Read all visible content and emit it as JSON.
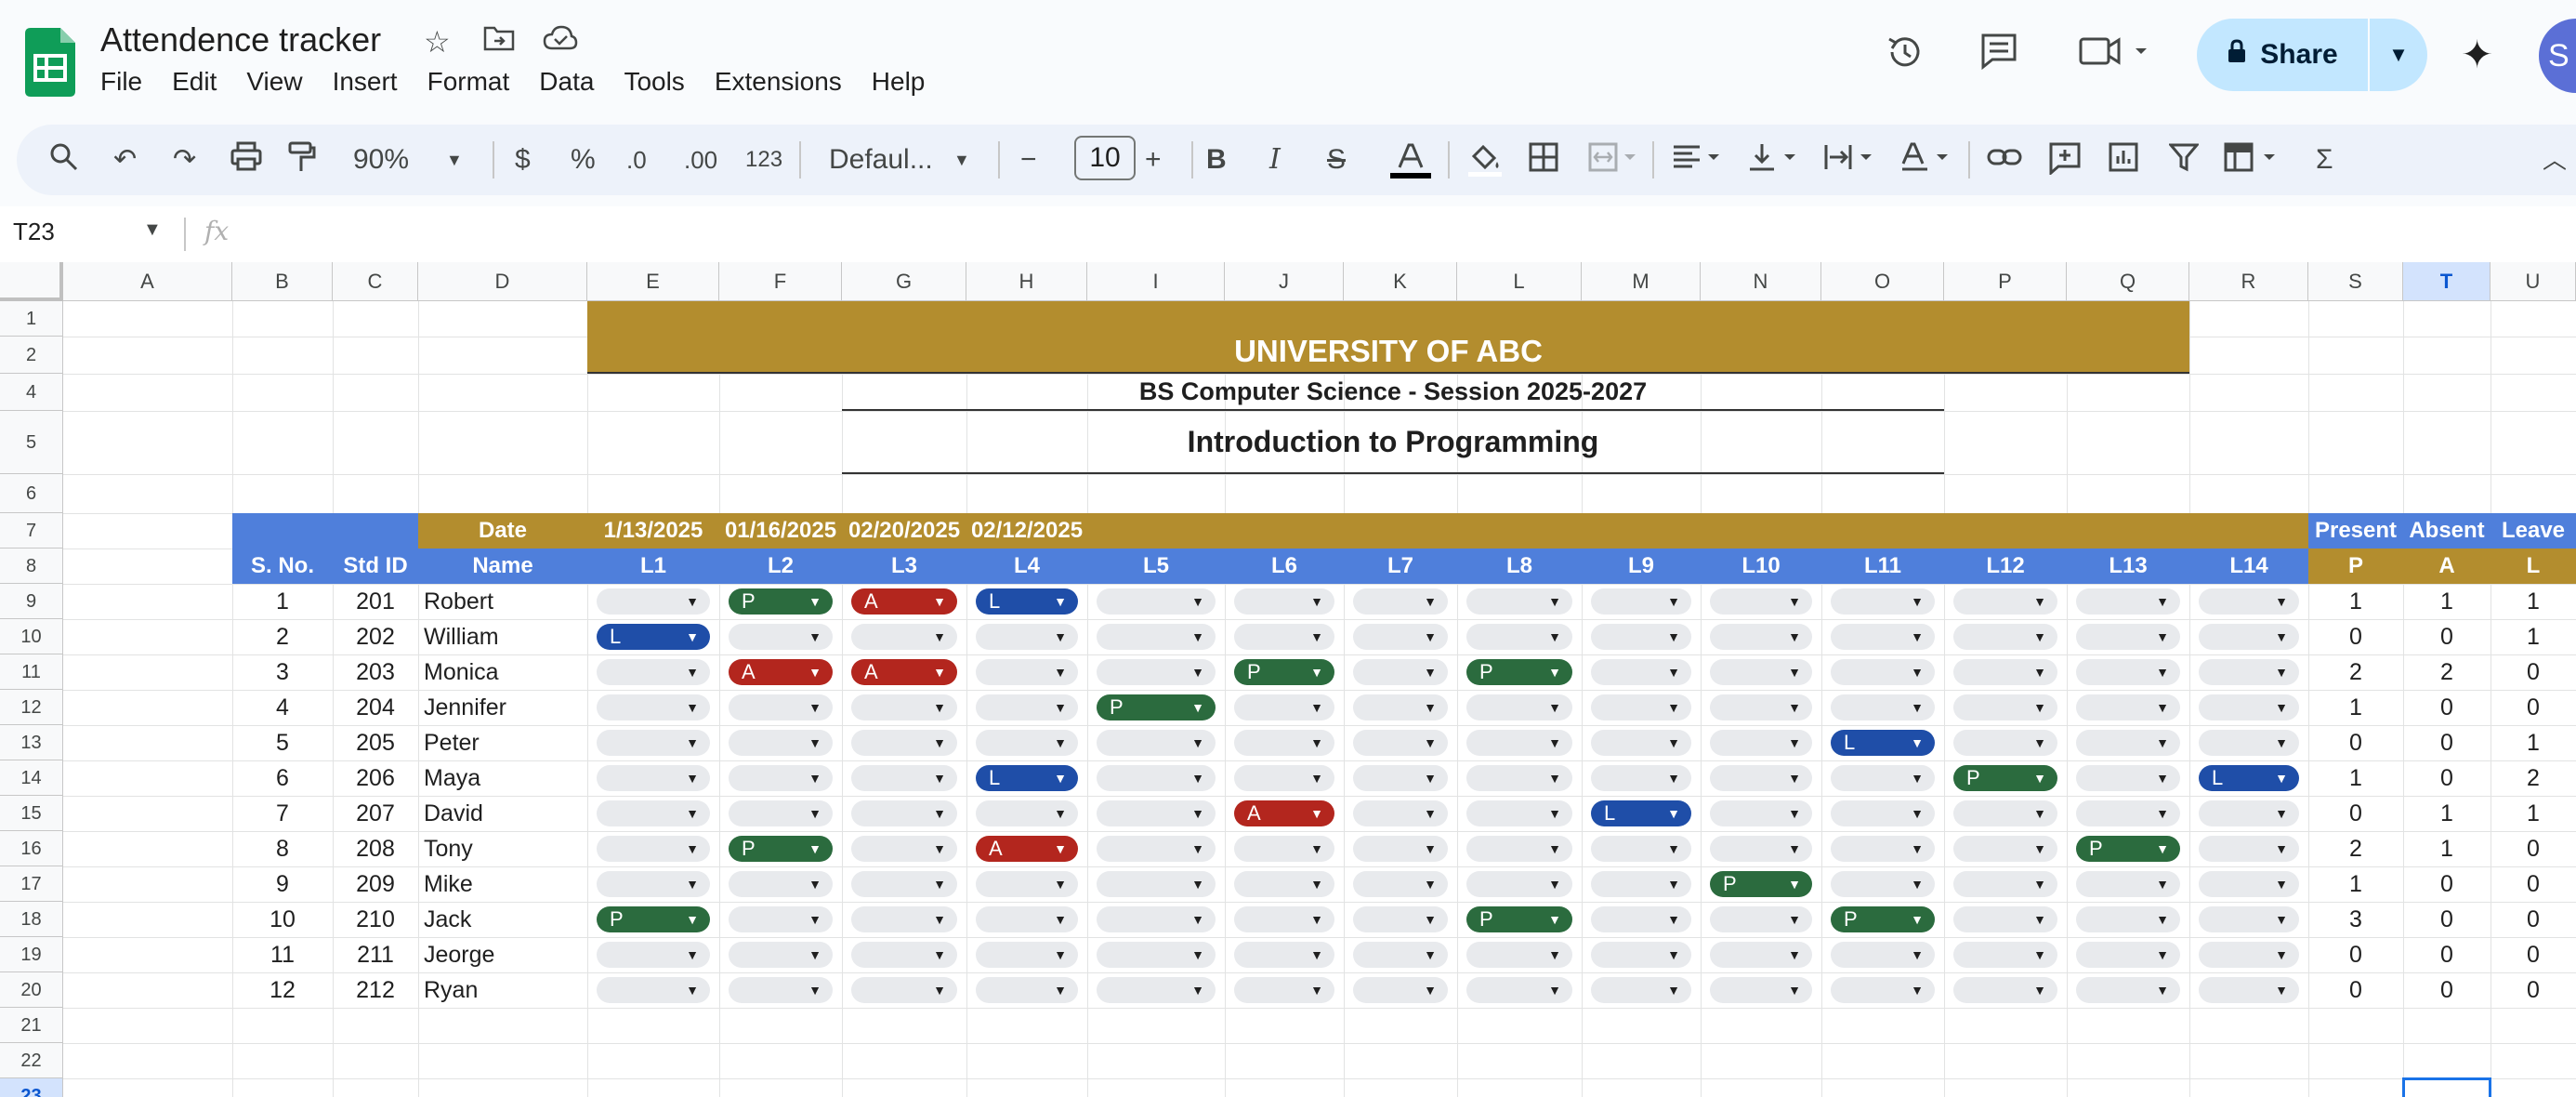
{
  "app": {
    "doc_title": "Attendence tracker",
    "menu": [
      "File",
      "Edit",
      "View",
      "Insert",
      "Format",
      "Data",
      "Tools",
      "Extensions",
      "Help"
    ],
    "share_label": "Share",
    "avatar_initial": "S",
    "brand_color": "#0f9d58",
    "share_color": "#c2e7ff"
  },
  "toolbar": {
    "zoom": "90%",
    "currency": "$",
    "percent": "%",
    "dec_decrease": ".0",
    "dec_increase": ".00",
    "number_format": "123",
    "font": "Defaul...",
    "font_size": "10",
    "bold": "B",
    "italic": "I",
    "sigma": "Σ"
  },
  "formula_bar": {
    "name_box": "T23",
    "fx": "fx",
    "formula": ""
  },
  "grid": {
    "columns": [
      "A",
      "B",
      "C",
      "D",
      "E",
      "F",
      "G",
      "H",
      "I",
      "J",
      "K",
      "L",
      "M",
      "N",
      "O",
      "P",
      "Q",
      "R",
      "S",
      "T",
      "U"
    ],
    "selected_column": "T",
    "rows": [
      "1",
      "2",
      "4",
      "5",
      "6",
      "7",
      "8",
      "9",
      "10",
      "11",
      "12",
      "13",
      "14",
      "15",
      "16",
      "17",
      "18",
      "19",
      "20",
      "21",
      "22",
      "23"
    ],
    "selected_row": "23",
    "colors": {
      "gold": "#b38d2e",
      "blue": "#4f7fdb",
      "present": "#2b6b3e",
      "absent": "#b3261e",
      "leave": "#1f4ea8"
    }
  },
  "sheet": {
    "university": "UNIVERSITY OF ABC",
    "program": "BS Computer Science - Session 2025-2027",
    "course": "Introduction to Programming",
    "date_label": "Date",
    "dates": [
      "1/13/2025",
      "01/16/2025",
      "02/20/2025",
      "02/12/2025"
    ],
    "headers": {
      "sno": "S. No.",
      "std_id": "Std ID",
      "name": "Name"
    },
    "lectures": [
      "L1",
      "L2",
      "L3",
      "L4",
      "L5",
      "L6",
      "L7",
      "L8",
      "L9",
      "L10",
      "L11",
      "L12",
      "L13",
      "L14"
    ],
    "summary_titles": [
      "Present",
      "Absent",
      "Leave"
    ],
    "summary_codes": [
      "P",
      "A",
      "L"
    ],
    "students": [
      {
        "sno": "1",
        "id": "201",
        "name": "Robert",
        "att": [
          "",
          "P",
          "A",
          "L",
          "",
          "",
          "",
          "",
          "",
          "",
          "",
          "",
          "",
          ""
        ],
        "p": "1",
        "a": "1",
        "l": "1"
      },
      {
        "sno": "2",
        "id": "202",
        "name": "William",
        "att": [
          "L",
          "",
          "",
          "",
          "",
          "",
          "",
          "",
          "",
          "",
          "",
          "",
          "",
          ""
        ],
        "p": "0",
        "a": "0",
        "l": "1"
      },
      {
        "sno": "3",
        "id": "203",
        "name": "Monica",
        "att": [
          "",
          "A",
          "A",
          "",
          "",
          "P",
          "",
          "P",
          "",
          "",
          "",
          "",
          "",
          ""
        ],
        "p": "2",
        "a": "2",
        "l": "0"
      },
      {
        "sno": "4",
        "id": "204",
        "name": "Jennifer",
        "att": [
          "",
          "",
          "",
          "",
          "P",
          "",
          "",
          "",
          "",
          "",
          "",
          "",
          "",
          ""
        ],
        "p": "1",
        "a": "0",
        "l": "0"
      },
      {
        "sno": "5",
        "id": "205",
        "name": "Peter",
        "att": [
          "",
          "",
          "",
          "",
          "",
          "",
          "",
          "",
          "",
          "",
          "L",
          "",
          "",
          ""
        ],
        "p": "0",
        "a": "0",
        "l": "1"
      },
      {
        "sno": "6",
        "id": "206",
        "name": "Maya",
        "att": [
          "",
          "",
          "",
          "L",
          "",
          "",
          "",
          "",
          "",
          "",
          "",
          "P",
          "",
          "L"
        ],
        "p": "1",
        "a": "0",
        "l": "2"
      },
      {
        "sno": "7",
        "id": "207",
        "name": "David",
        "att": [
          "",
          "",
          "",
          "",
          "",
          "A",
          "",
          "",
          "L",
          "",
          "",
          "",
          "",
          ""
        ],
        "p": "0",
        "a": "1",
        "l": "1"
      },
      {
        "sno": "8",
        "id": "208",
        "name": "Tony",
        "att": [
          "",
          "P",
          "",
          "A",
          "",
          "",
          "",
          "",
          "",
          "",
          "",
          "",
          "P",
          ""
        ],
        "p": "2",
        "a": "1",
        "l": "0"
      },
      {
        "sno": "9",
        "id": "209",
        "name": "Mike",
        "att": [
          "",
          "",
          "",
          "",
          "",
          "",
          "",
          "",
          "",
          "P",
          "",
          "",
          "",
          ""
        ],
        "p": "1",
        "a": "0",
        "l": "0"
      },
      {
        "sno": "10",
        "id": "210",
        "name": "Jack",
        "att": [
          "P",
          "",
          "",
          "",
          "",
          "",
          "",
          "P",
          "",
          "",
          "P",
          "",
          "",
          ""
        ],
        "p": "3",
        "a": "0",
        "l": "0"
      },
      {
        "sno": "11",
        "id": "211",
        "name": "Jeorge",
        "att": [
          "",
          "",
          "",
          "",
          "",
          "",
          "",
          "",
          "",
          "",
          "",
          "",
          "",
          ""
        ],
        "p": "0",
        "a": "0",
        "l": "0"
      },
      {
        "sno": "12",
        "id": "212",
        "name": "Ryan",
        "att": [
          "",
          "",
          "",
          "",
          "",
          "",
          "",
          "",
          "",
          "",
          "",
          "",
          "",
          ""
        ],
        "p": "0",
        "a": "0",
        "l": "0"
      }
    ]
  }
}
